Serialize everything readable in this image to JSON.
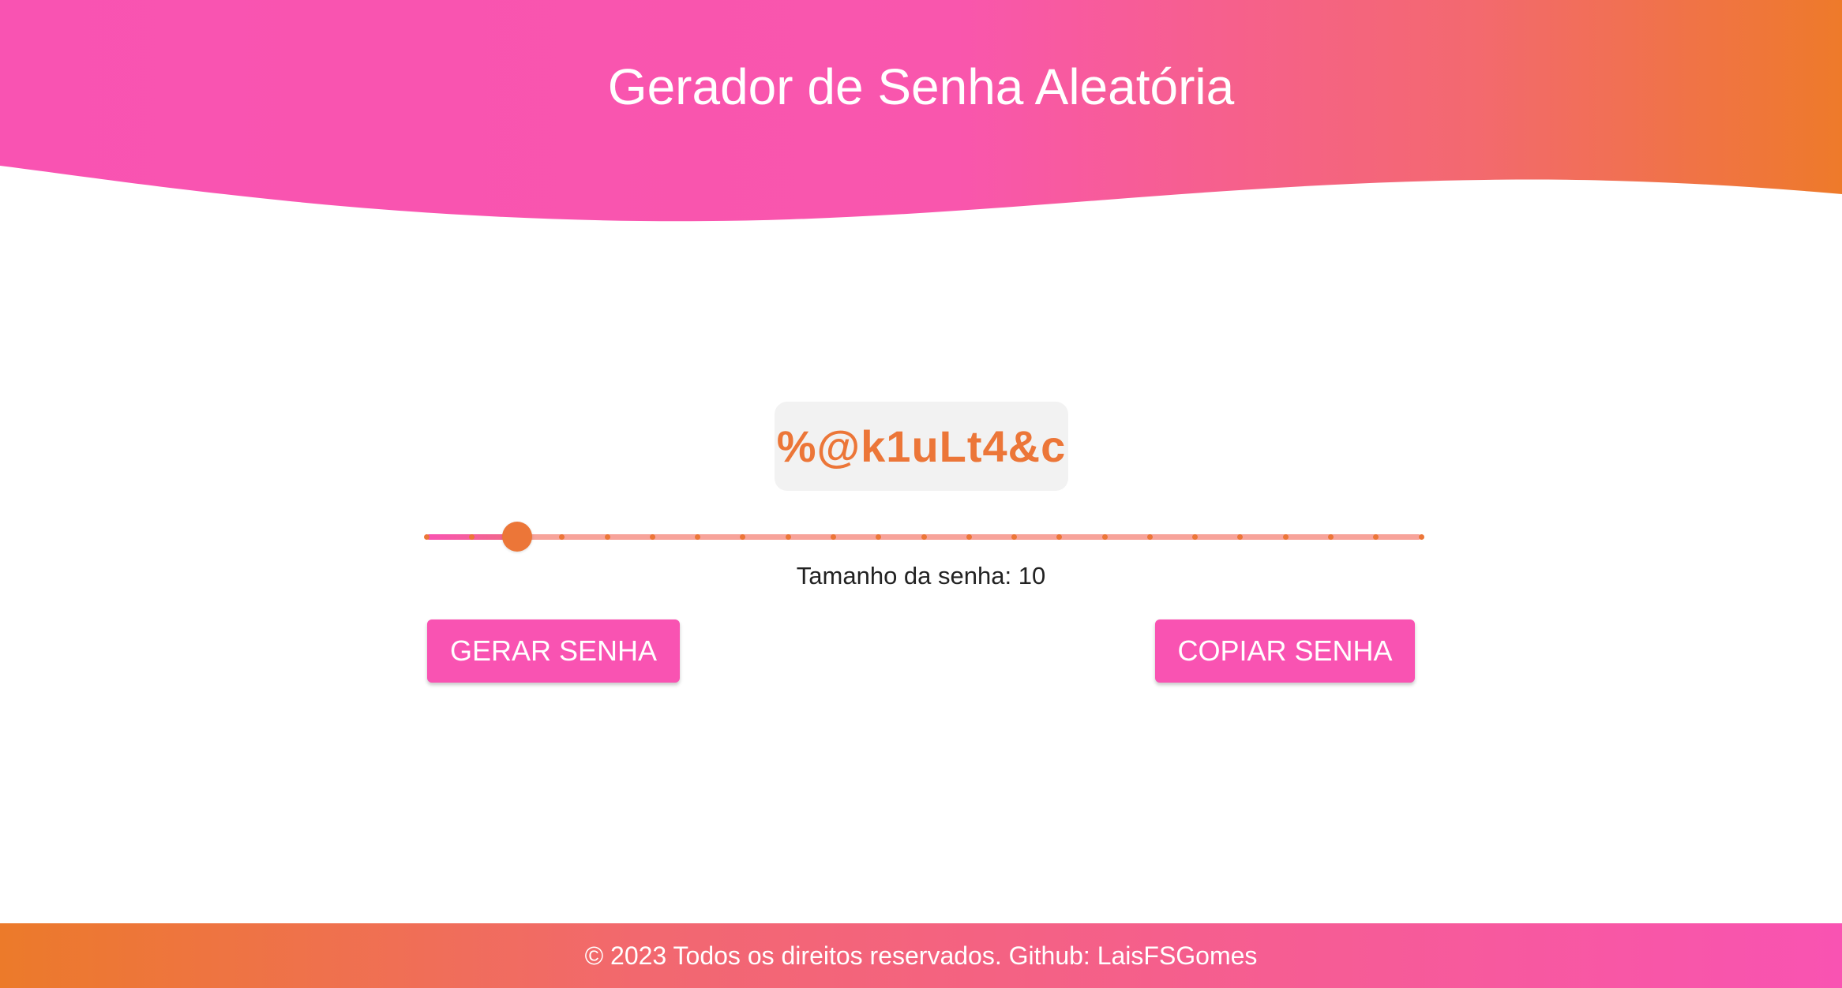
{
  "header": {
    "title": "Gerador de Senha Aleatória"
  },
  "password": {
    "value": "%@k1uLt4&c"
  },
  "slider": {
    "value": 10,
    "min": 8,
    "max": 30,
    "step": 1
  },
  "size_label": "Tamanho da senha: 10",
  "buttons": {
    "generate_label": "GERAR SENHA",
    "copy_label": "COPIAR SENHA"
  },
  "footer": {
    "text": "© 2023 Todos os direitos reservados. Github: LaisFSGomes"
  },
  "colors": {
    "pink": "#f953b2",
    "orange": "#ec7638",
    "rail": "#f7a39a",
    "password_box": "#f2f2f2"
  }
}
